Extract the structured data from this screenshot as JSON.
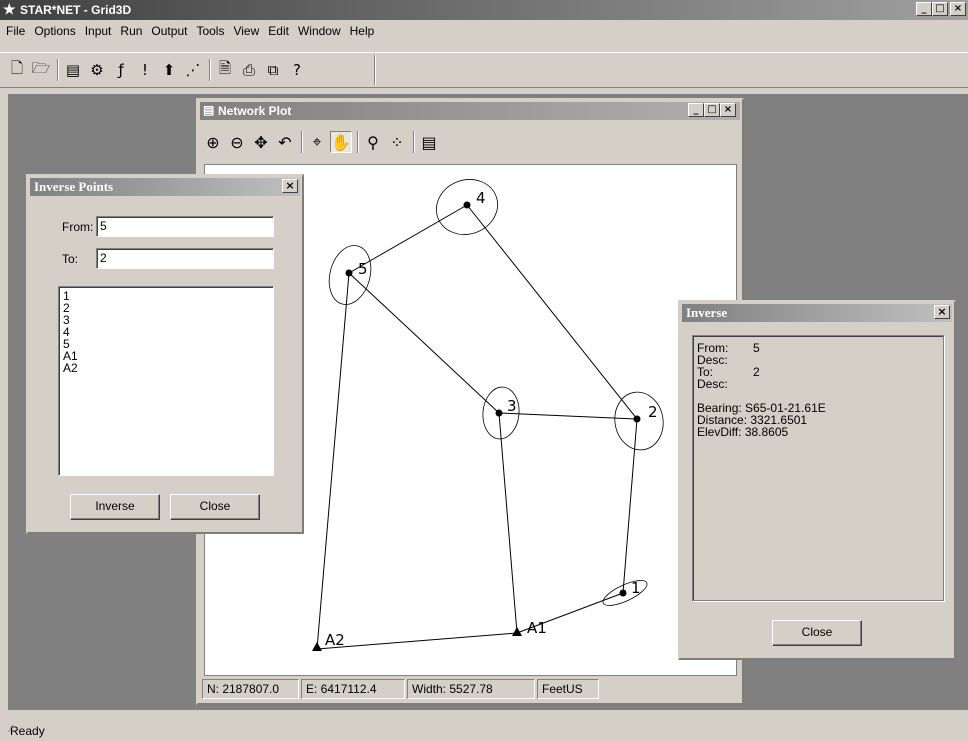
{
  "app": {
    "title": "STAR*NET - Grid3D",
    "logo_icon": "star-logo-icon"
  },
  "menu": [
    "File",
    "Options",
    "Input",
    "Run",
    "Output",
    "Tools",
    "View",
    "Edit",
    "Window",
    "Help"
  ],
  "toolbar": {
    "buttons": [
      "new-file-icon",
      "open-folder-icon",
      "edit-input-icon",
      "process-icon",
      "run-adjust-icon",
      "warning-icon",
      "up-arrow-icon",
      "network-icon",
      "print-preview-icon",
      "print-icon",
      "copy-icon",
      "help-icon"
    ]
  },
  "status_bar": {
    "text": "Ready"
  },
  "network_plot": {
    "title": "Network Plot",
    "tools": [
      "zoom-in-icon",
      "zoom-out-icon",
      "pan-icon",
      "undo-icon",
      "center-icon",
      "hand-icon",
      "find-icon",
      "points-icon",
      "list-icon"
    ],
    "status": {
      "north": "N: 2187807.0",
      "east": "E: 6417112.4",
      "width": "Width: 5527.78",
      "units": "FeetUS"
    },
    "points": [
      {
        "label": "1"
      },
      {
        "label": "2"
      },
      {
        "label": "3"
      },
      {
        "label": "4"
      },
      {
        "label": "5"
      },
      {
        "label": "A1"
      },
      {
        "label": "A2"
      }
    ]
  },
  "inverse_points": {
    "title": "Inverse Points",
    "from_label": "From:",
    "from_value": "5",
    "to_label": "To:",
    "to_value": "2",
    "list": [
      "1",
      "2",
      "3",
      "4",
      "5",
      "A1",
      "A2"
    ],
    "inverse_button": "Inverse",
    "close_button": "Close"
  },
  "inverse_result": {
    "title": "Inverse",
    "from_label": "From:",
    "from_value": "5",
    "desc1_label": "Desc:",
    "to_label": "To:",
    "to_value": "2",
    "desc2_label": "Desc:",
    "bearing_label": "Bearing:",
    "bearing_value": "S65-01-21.61E",
    "distance_label": "Distance:",
    "distance_value": "3321.6501",
    "elevdiff_label": "ElevDiff:",
    "elevdiff_value": "38.8605",
    "close_button": "Close"
  }
}
